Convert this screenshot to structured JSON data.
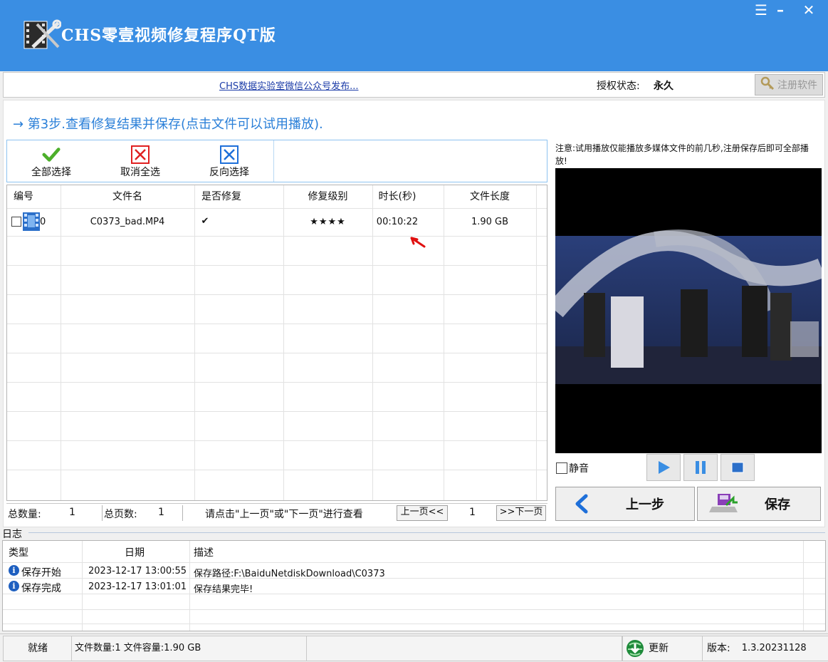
{
  "window": {
    "title": "CHS零壹视频修复程序QT版",
    "controls": [
      "☰",
      "–",
      "✕"
    ]
  },
  "infobar": {
    "wechat_link": "CHS数据实验室微信公众号发布...",
    "auth_label": "授权状态:",
    "auth_value": "永久",
    "register_button": "注册软件"
  },
  "step": {
    "text": "→ 第3步.查看修复结果并保存(点击文件可以试用播放)."
  },
  "toolbar": {
    "select_all": "全部选择",
    "deselect_all": "取消全选",
    "invert_selection": "反向选择"
  },
  "table": {
    "headers": [
      "编号",
      "文件名",
      "是否修复",
      "修复级别",
      "时长(秒)",
      "文件长度"
    ],
    "rows": [
      {
        "index": "0",
        "filename": "C0373_bad.MP4",
        "repaired": "✔",
        "level": "★★★★",
        "duration": "00:10:22",
        "size": "1.90 GB"
      }
    ]
  },
  "pagination": {
    "total_count_label": "总数量:",
    "total_count": "1",
    "total_pages_label": "总页数:",
    "total_pages": "1",
    "hint": "请点击\"上一页\"或\"下一页\"进行查看",
    "prev_button": "上一页<<",
    "current_page": "1",
    "next_button": ">>下一页"
  },
  "preview": {
    "note": "注意:试用播放仅能播放多媒体文件的前几秒,注册保存后即可全部播放!",
    "mute_label": "静音",
    "back_button": "上一步",
    "save_button": "保存"
  },
  "log": {
    "legend": "日志",
    "headers": [
      "类型",
      "日期",
      "描述"
    ],
    "rows": [
      {
        "type": "保存开始",
        "date": "2023-12-17 13:00:55",
        "desc": "保存路径:F:\\BaiduNetdiskDownload\\C0373"
      },
      {
        "type": "保存完成",
        "date": "2023-12-17 13:01:01",
        "desc": "保存结果完毕!"
      }
    ]
  },
  "statusbar": {
    "state": "就绪",
    "file_info": "文件数量:1 文件容量:1.90 GB",
    "update_label": "更新",
    "version_label": "版本:",
    "version_value": "1.3.20231128"
  },
  "colors": {
    "titlebar": "#3a8ee3",
    "step_text": "#2a7fd8",
    "link": "#1c3ca8",
    "accent_blue": "#1e6fd9",
    "annotation_arrow": "#e01010"
  }
}
